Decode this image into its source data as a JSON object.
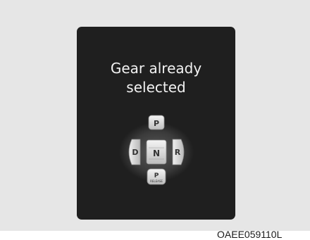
{
  "display": {
    "message_line1": "Gear already",
    "message_line2": "selected"
  },
  "shifter": {
    "park_label": "P",
    "reverse_label": "R",
    "neutral_label": "N",
    "drive_label": "D",
    "park_release_label": "P",
    "park_release_sublabel": "RELEASE"
  },
  "caption": "OAEE059110L",
  "colors": {
    "background": "#e6e6e6",
    "screen": "#1f1f1f",
    "button_face": "#dcdcdc",
    "text_light": "#f2f2f2"
  },
  "icons": [
    "gear-shift-buttons"
  ]
}
